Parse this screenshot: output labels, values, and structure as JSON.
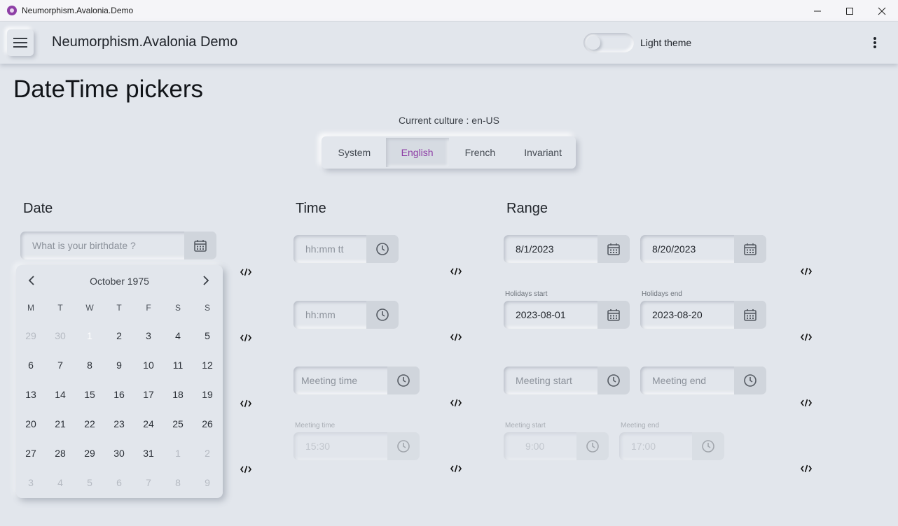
{
  "window": {
    "title": "Neumorphism.Avalonia.Demo"
  },
  "appbar": {
    "title": "Neumorphism.Avalonia Demo",
    "theme_label": "Light theme"
  },
  "page": {
    "title": "DateTime pickers",
    "culture_text": "Current culture : en-US",
    "culture_options": [
      "System",
      "English",
      "French",
      "Invariant"
    ],
    "culture_selected": "English"
  },
  "sections": {
    "date": "Date",
    "time": "Time",
    "range": "Range"
  },
  "date": {
    "birthdate_placeholder": "What is your birthdate ?",
    "calendar": {
      "month_label": "October 1975",
      "weekdays": [
        "M",
        "T",
        "W",
        "T",
        "F",
        "S",
        "S"
      ],
      "selected_day": "1",
      "weeks": [
        [
          "29",
          "30",
          "1",
          "2",
          "3",
          "4",
          "5"
        ],
        [
          "6",
          "7",
          "8",
          "9",
          "10",
          "11",
          "12"
        ],
        [
          "13",
          "14",
          "15",
          "16",
          "17",
          "18",
          "19"
        ],
        [
          "20",
          "21",
          "22",
          "23",
          "24",
          "25",
          "26"
        ],
        [
          "27",
          "28",
          "29",
          "30",
          "31",
          "1",
          "2"
        ],
        [
          "3",
          "4",
          "5",
          "6",
          "7",
          "8",
          "9"
        ]
      ]
    }
  },
  "time": {
    "f1_placeholder": "hh:mm tt",
    "f2_placeholder": "hh:mm",
    "f3_placeholder": "Meeting time",
    "f4_label": "Meeting time",
    "f4_value": "15:30"
  },
  "range": {
    "r1_start": "8/1/2023",
    "r1_end": "8/20/2023",
    "r2_start_label": "Holidays start",
    "r2_end_label": "Holidays end",
    "r2_start": "2023-08-01",
    "r2_end": "2023-08-20",
    "r3_start_placeholder": "Meeting start",
    "r3_end_placeholder": "Meeting end",
    "r4_start_label": "Meeting start",
    "r4_end_label": "Meeting end",
    "r4_start": "9:00",
    "r4_end": "17:00"
  }
}
